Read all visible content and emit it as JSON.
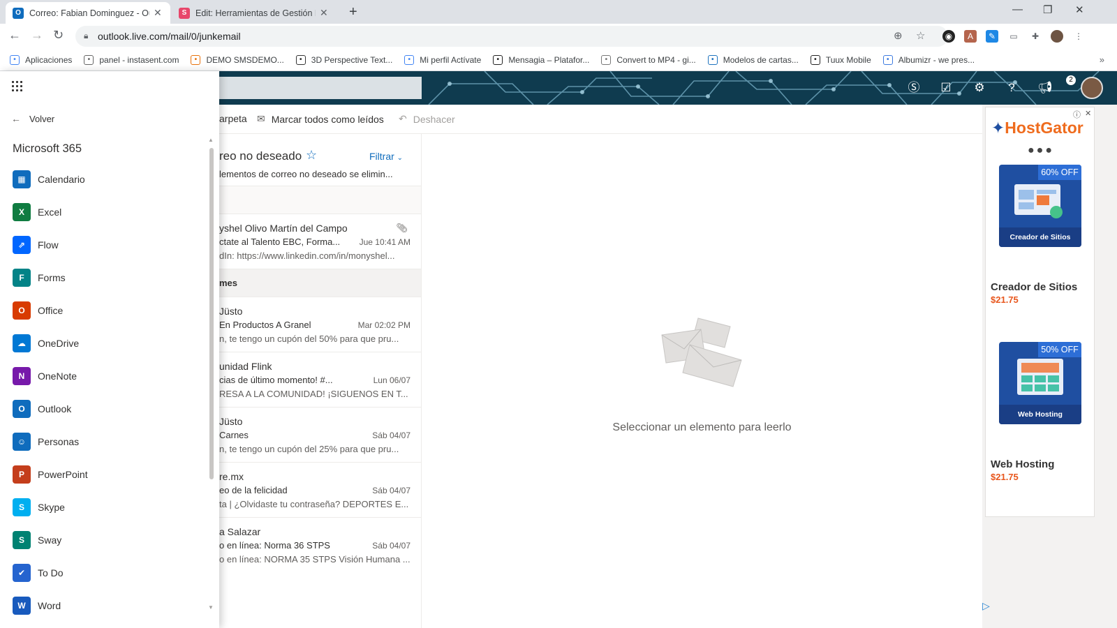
{
  "browser": {
    "tabs": [
      {
        "title": "Correo: Fabian Dominguez - Outl",
        "favicon": "outlook-favicon",
        "color": "#0f6cbd",
        "letter": "O"
      },
      {
        "title": "Edit: Herramientas de Gestión Di",
        "favicon": "s-favicon",
        "color": "#e8476b",
        "letter": "S"
      }
    ],
    "url": "outlook.live.com/mail/0/junkemail",
    "bookmarks": [
      {
        "label": "Aplicaciones",
        "icon": "apps-grid-icon",
        "color": "#4285f4"
      },
      {
        "label": "panel - instasent.com",
        "icon": "instasent-icon",
        "color": "#666"
      },
      {
        "label": "DEMO SMSDEMO...",
        "icon": "diamond-icon",
        "color": "#e8710a"
      },
      {
        "label": "3D Perspective Text...",
        "icon": "3d-icon",
        "color": "#333"
      },
      {
        "label": "Mi perfil Actívate",
        "icon": "google-icon",
        "color": "#4285f4"
      },
      {
        "label": "Mensagia – Platafor...",
        "icon": "mensagia-icon",
        "color": "#222"
      },
      {
        "label": "Convert to MP4 - gi...",
        "icon": "cloud-icon",
        "color": "#777"
      },
      {
        "label": "Modelos de cartas...",
        "icon": "w-icon",
        "color": "#1e73be"
      },
      {
        "label": "Tuux Mobile",
        "icon": "tuux-icon",
        "color": "#222"
      },
      {
        "label": "Albumizr - we pres...",
        "icon": "albumizr-icon",
        "color": "#3d7be0"
      }
    ]
  },
  "launcher": {
    "back_label": "Volver",
    "section_title": "Microsoft 365",
    "apps": [
      {
        "label": "Calendario",
        "icon": "calendar-icon",
        "color": "#0f6cbd",
        "letter": "▦"
      },
      {
        "label": "Excel",
        "icon": "excel-icon",
        "color": "#107c41",
        "letter": "X"
      },
      {
        "label": "Flow",
        "icon": "flow-icon",
        "color": "#0066ff",
        "letter": "⇗"
      },
      {
        "label": "Forms",
        "icon": "forms-icon",
        "color": "#038387",
        "letter": "F"
      },
      {
        "label": "Office",
        "icon": "office-icon",
        "color": "#d83b01",
        "letter": "O"
      },
      {
        "label": "OneDrive",
        "icon": "onedrive-icon",
        "color": "#0078d4",
        "letter": "☁"
      },
      {
        "label": "OneNote",
        "icon": "onenote-icon",
        "color": "#7719aa",
        "letter": "N"
      },
      {
        "label": "Outlook",
        "icon": "outlook-icon",
        "color": "#0f6cbd",
        "letter": "O"
      },
      {
        "label": "Personas",
        "icon": "people-icon",
        "color": "#0f6cbd",
        "letter": "☺"
      },
      {
        "label": "PowerPoint",
        "icon": "powerpoint-icon",
        "color": "#c43e1c",
        "letter": "P"
      },
      {
        "label": "Skype",
        "icon": "skype-icon",
        "color": "#00aff0",
        "letter": "S"
      },
      {
        "label": "Sway",
        "icon": "sway-icon",
        "color": "#008272",
        "letter": "S"
      },
      {
        "label": "To Do",
        "icon": "todo-icon",
        "color": "#2564cf",
        "letter": "✔"
      },
      {
        "label": "Word",
        "icon": "word-icon",
        "color": "#185abd",
        "letter": "W"
      }
    ]
  },
  "commands": {
    "move_folder": "arpeta",
    "mark_all_read": "Marcar todos como leídos",
    "undo": "Deshacer"
  },
  "list": {
    "folder_title": "reo no deseado",
    "filter_label": "Filtrar",
    "notice": "lementos de correo no deseado se elimin...",
    "groups": [
      {
        "label": "mes"
      }
    ],
    "mails": [
      {
        "from": "yshel Olivo Martín del Campo",
        "subject": "ctate al Talento EBC, Forma...",
        "date": "Jue 10:41 AM",
        "preview": "dIn: https://www.linkedin.com/in/monyshel...",
        "attachment": true
      },
      {
        "from": "Jüsto",
        "subject": "En Productos A Granel",
        "date": "Mar 02:02 PM",
        "preview": "n, te tengo un cupón del 50% para que pru...",
        "attachment": false
      },
      {
        "from": "unidad Flink",
        "subject": "cias de último momento! #...",
        "date": "Lun 06/07",
        "preview": "RESA A LA COMUNIDAD! ¡SIGUENOS EN T...",
        "attachment": false
      },
      {
        "from": "Jüsto",
        "subject": "Carnes",
        "date": "Sáb 04/07",
        "preview": "n, te tengo un cupón del 25% para que pru...",
        "attachment": false
      },
      {
        "from": "re.mx",
        "subject": "eo de la felicidad",
        "date": "Sáb 04/07",
        "preview": "ta | ¿Olvidaste tu contraseña? DEPORTES E...",
        "attachment": false
      },
      {
        "from": "a Salazar",
        "subject": "o en línea: Norma 36 STPS",
        "date": "Sáb 04/07",
        "preview": "o en línea: NORMA 35 STPS Visión Humana ...",
        "attachment": false
      }
    ]
  },
  "reading": {
    "empty_text": "Seleccionar un elemento para leerlo"
  },
  "header": {
    "notification_count": "2"
  },
  "ad": {
    "brand": "HostGator",
    "products": [
      {
        "discount": "60% OFF",
        "caption": "Creador de Sitios",
        "title": "Creador de Sitios",
        "price": "$21.75"
      },
      {
        "discount": "50% OFF",
        "caption": "Web Hosting",
        "title": "Web Hosting",
        "price": "$21.75"
      }
    ]
  },
  "colors": {
    "outlook_blue": "#0f6cbd",
    "header_bg": "#0f3b4f",
    "ad_orange": "#e8561c"
  }
}
